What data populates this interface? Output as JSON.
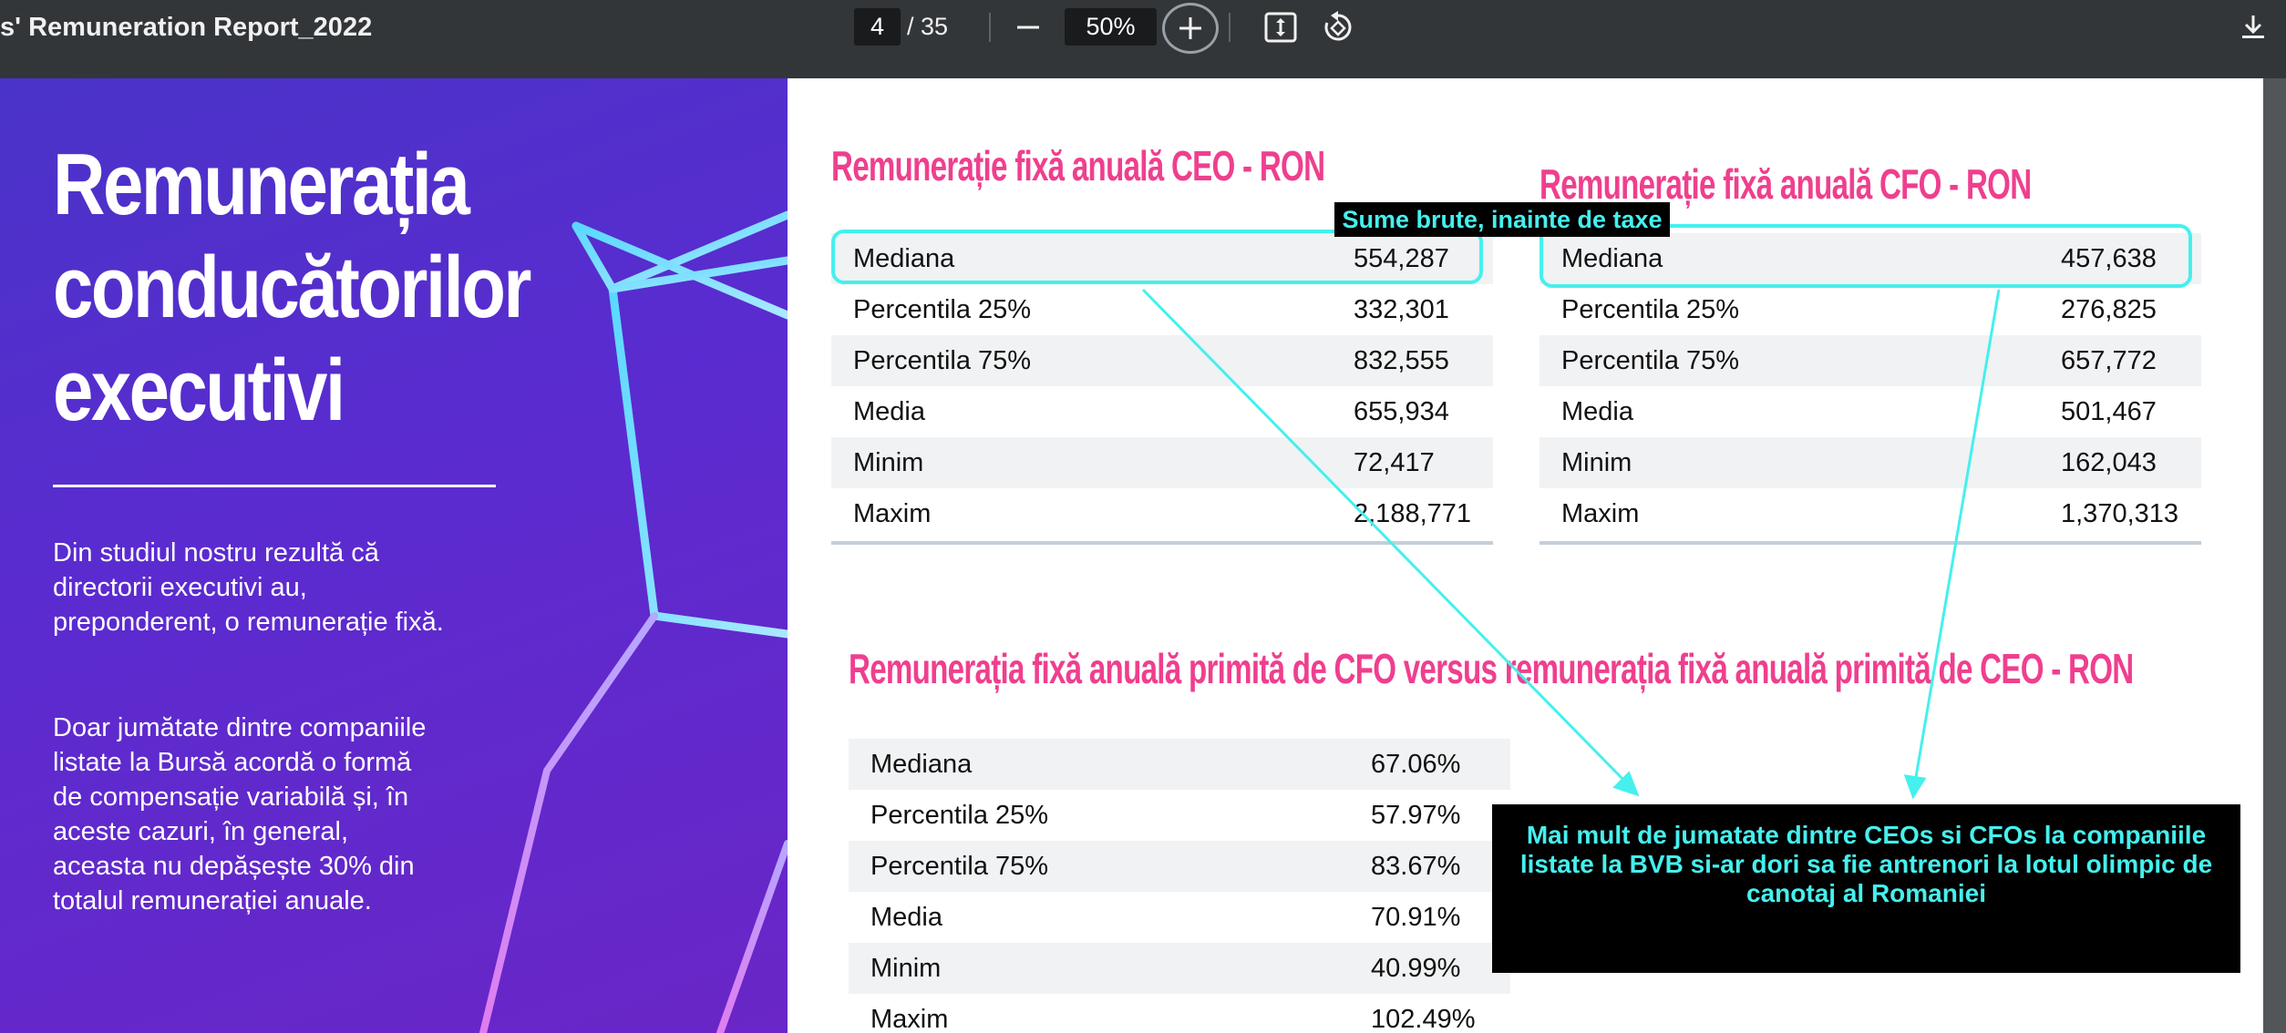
{
  "toolbar": {
    "document_title": "s' Remuneration Report_2022",
    "current_page": "4",
    "page_total": "/ 35",
    "zoom": "50%",
    "icons": [
      "minus-icon",
      "plus-icon",
      "fit-page-icon",
      "rotate-icon",
      "download-icon"
    ]
  },
  "left_panel": {
    "heading_lines": [
      "Remunerația",
      "conducătorilor",
      "executivi"
    ],
    "paragraph_1": "Din studiul nostru rezultă că directorii executivi au, preponderent, o remunerație fixă.",
    "paragraph_2": "Doar jumătate dintre companiile listate la Bursă acordă o formă de compensație variabilă și, în aceste cazuri, în general, aceasta nu depășește 30% din totalul remunerației anuale.",
    "colors": {
      "gradient_start": "#4a33c8",
      "gradient_end": "#6a26c6"
    }
  },
  "ceo_table": {
    "title": "Remunerație fixă anuală CEO - RON",
    "rows": [
      {
        "label": "Mediana",
        "value": "554,287"
      },
      {
        "label": "Percentila 25%",
        "value": "332,301"
      },
      {
        "label": "Percentila 75%",
        "value": "832,555"
      },
      {
        "label": "Media",
        "value": "655,934"
      },
      {
        "label": "Minim",
        "value": "72,417"
      },
      {
        "label": "Maxim",
        "value": "2,188,771"
      }
    ]
  },
  "cfo_table": {
    "title": "Remunerație fixă anuală CFO - RON",
    "rows": [
      {
        "label": "Mediana",
        "value": "457,638"
      },
      {
        "label": "Percentila 25%",
        "value": "276,825"
      },
      {
        "label": "Percentila 75%",
        "value": "657,772"
      },
      {
        "label": "Media",
        "value": "501,467"
      },
      {
        "label": "Minim",
        "value": "162,043"
      },
      {
        "label": "Maxim",
        "value": "1,370,313"
      }
    ]
  },
  "ratio_table": {
    "title": "Remunerația fixă anuală primită de CFO versus remunerația fixă anuală primită de CEO - RON",
    "rows": [
      {
        "label": "Mediana",
        "value": "67.06%"
      },
      {
        "label": "Percentila 25%",
        "value": "57.97%"
      },
      {
        "label": "Percentila 75%",
        "value": "83.67%"
      },
      {
        "label": "Media",
        "value": "70.91%"
      },
      {
        "label": "Minim",
        "value": "40.99%"
      },
      {
        "label": "Maxim",
        "value": "102.49%"
      }
    ]
  },
  "annotations": {
    "small_note": "Sume brute, inainte de taxe",
    "big_note": "Mai mult de jumatate dintre CEOs si CFOs la companiile listate la BVB si-ar dori sa fie antrenori la lotul olimpic de canotaj al Romaniei",
    "accent_color": "#45f0ee"
  },
  "colors": {
    "title_pink": "#ef3f8e",
    "toolbar_bg": "#323639"
  }
}
